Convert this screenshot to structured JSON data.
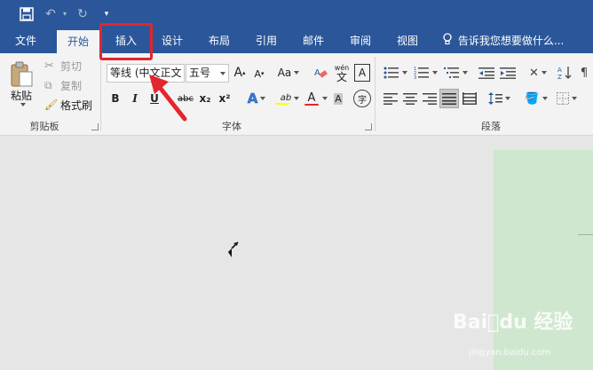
{
  "tabs": [
    "文件",
    "开始",
    "插入",
    "设计",
    "布局",
    "引用",
    "邮件",
    "审阅",
    "视图"
  ],
  "tell_me": "告诉我您想要做什么...",
  "clipboard": {
    "paste": "粘贴",
    "cut": "剪切",
    "copy": "复制",
    "format_painter": "格式刷",
    "group_label": "剪贴板"
  },
  "font": {
    "font_name": "等线 (中文正文",
    "font_size": "五号",
    "bold": "B",
    "italic": "I",
    "underline": "U",
    "strikethrough": "abc",
    "subscript": "x₂",
    "superscript": "x²",
    "change_case": "Aa",
    "grow": "A",
    "shrink": "A",
    "phonetic_top": "wén",
    "phonetic_bottom": "文",
    "char_border": "A",
    "text_effects": "A",
    "highlight": "ab",
    "font_color": "A",
    "enclose": "字",
    "group_label": "字体"
  },
  "paragraph": {
    "group_label": "段落"
  },
  "watermark": {
    "brand": "Bai⃝du 经验",
    "url": "jingyan.baidu.com"
  },
  "colors": {
    "brand": "#2b579a",
    "ribbon": "#f3f3f3",
    "annotation": "#e3252c",
    "page": "#cfe7cf",
    "highlight_yellow": "#ffff00",
    "font_red": "#e3252c"
  }
}
